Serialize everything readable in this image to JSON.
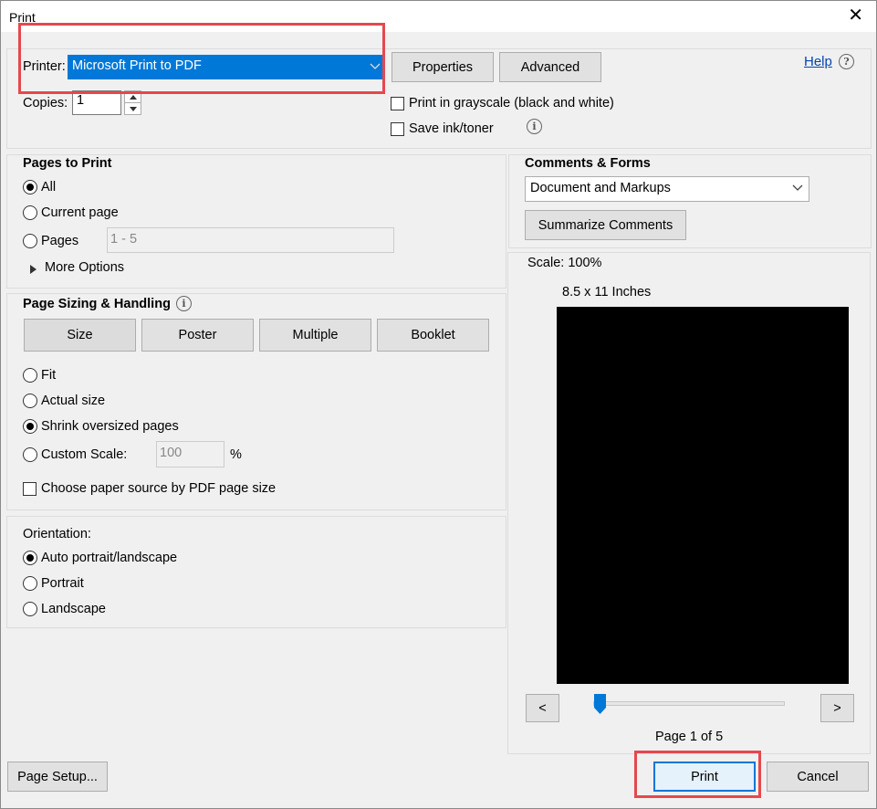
{
  "window": {
    "title": "Print",
    "close_glyph": "✕"
  },
  "printer": {
    "label": "Printer:",
    "selected": "Microsoft Print to PDF",
    "properties_button": "Properties",
    "advanced_button": "Advanced",
    "help_link": "Help",
    "copies_label": "Copies:",
    "copies_value": "1",
    "grayscale_label": "Print in grayscale (black and white)",
    "grayscale_checked": false,
    "save_ink_label": "Save ink/toner",
    "save_ink_checked": false
  },
  "pages_to_print": {
    "heading": "Pages to Print",
    "options": {
      "all": "All",
      "current": "Current page",
      "pages": "Pages"
    },
    "selected": "all",
    "pages_value": "1 - 5",
    "more_options": "More Options"
  },
  "sizing": {
    "heading": "Page Sizing & Handling",
    "tabs": [
      "Size",
      "Poster",
      "Multiple",
      "Booklet"
    ],
    "options": {
      "fit": "Fit",
      "actual": "Actual size",
      "shrink": "Shrink oversized pages",
      "custom": "Custom Scale:"
    },
    "selected": "shrink",
    "custom_scale_value": "100",
    "custom_scale_unit": "%",
    "paper_source_label": "Choose paper source by PDF page size",
    "paper_source_checked": false
  },
  "orientation": {
    "heading": "Orientation:",
    "options": {
      "auto": "Auto portrait/landscape",
      "portrait": "Portrait",
      "landscape": "Landscape"
    },
    "selected": "auto"
  },
  "comments_forms": {
    "heading": "Comments & Forms",
    "selected": "Document and Markups",
    "summarize_button": "Summarize Comments"
  },
  "preview": {
    "scale_label": "Scale: 100%",
    "paper_size": "8.5 x 11 Inches",
    "prev_glyph": "<",
    "next_glyph": ">",
    "page_indicator": "Page 1 of 5",
    "slider_position": 0
  },
  "footer": {
    "page_setup_button": "Page Setup...",
    "print_button": "Print",
    "cancel_button": "Cancel"
  },
  "colors": {
    "highlight_red": "#e5484d",
    "selection_blue": "#0078d7",
    "slider_blue": "#0078d7"
  }
}
